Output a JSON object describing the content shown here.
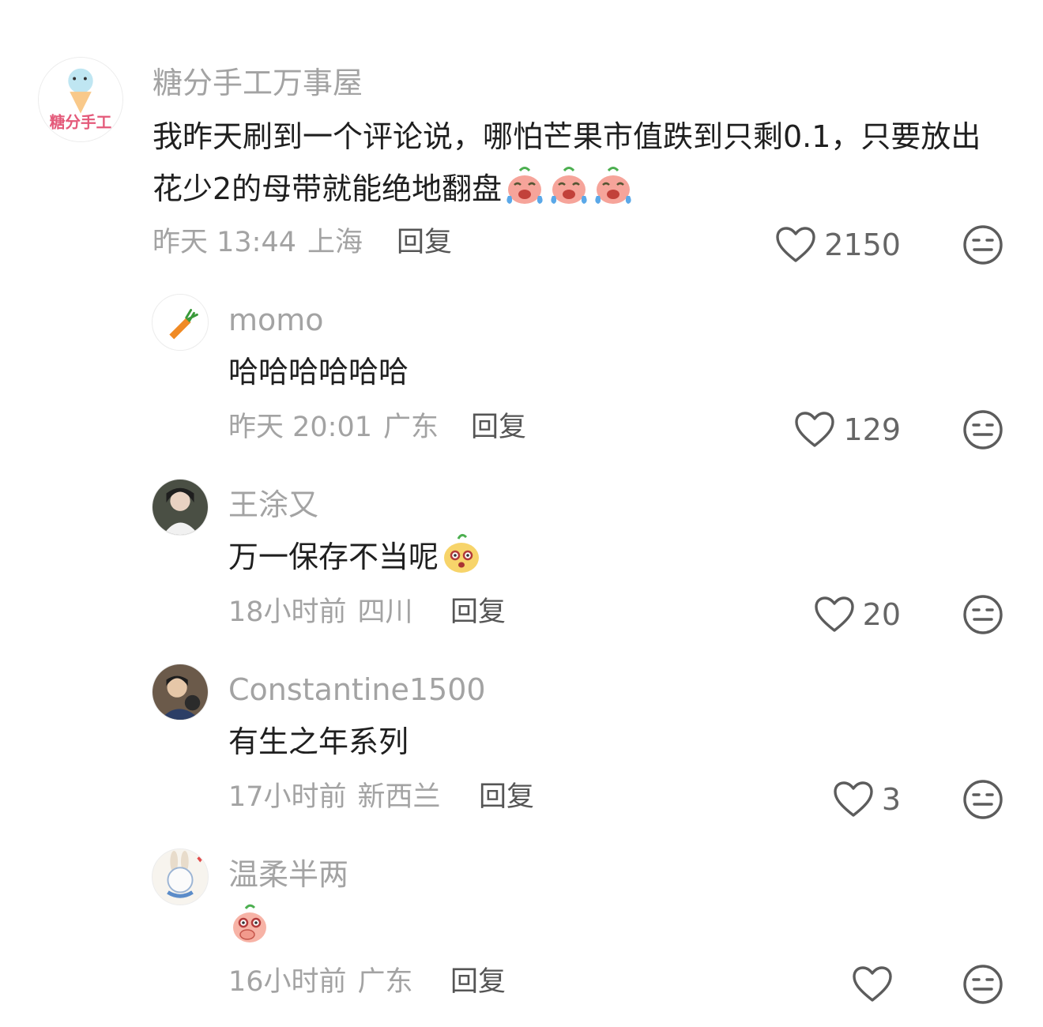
{
  "comments": [
    {
      "username": "糖分手工万事屋",
      "content": "我昨天刷到一个评论说，哪怕芒果市值跌到只剩0.1，只要放出花少2的母带就能绝地翻盘",
      "avatar_text": "糖分手工",
      "time": "昨天 13:44",
      "location": "上海",
      "reply": "回复",
      "likes": "2150"
    },
    {
      "username": "momo",
      "content": "哈哈哈哈哈哈",
      "time": "昨天 20:01",
      "location": "广东",
      "reply": "回复",
      "likes": "129"
    },
    {
      "username": "王涂又",
      "content": "万一保存不当呢",
      "time": "18小时前",
      "location": "四川",
      "reply": "回复",
      "likes": "20"
    },
    {
      "username": "Constantine1500",
      "content": "有生之年系列",
      "time": "17小时前",
      "location": "新西兰",
      "reply": "回复",
      "likes": "3"
    },
    {
      "username": "温柔半两",
      "content": "",
      "time": "16小时前",
      "location": "广东",
      "reply": "回复",
      "likes": ""
    }
  ],
  "icons": {
    "like": "heart-outline-icon",
    "dislike": "meh-face-icon",
    "emoji_cry": "crying-laugh-sticker",
    "emoji_shock": "shocked-face-sticker",
    "emoji_cover": "cover-mouth-sticker"
  },
  "colors": {
    "username": "#a3a3a3",
    "content": "#1f1f1f",
    "meta": "#a3a3a3",
    "icon": "#5c5c5c"
  }
}
